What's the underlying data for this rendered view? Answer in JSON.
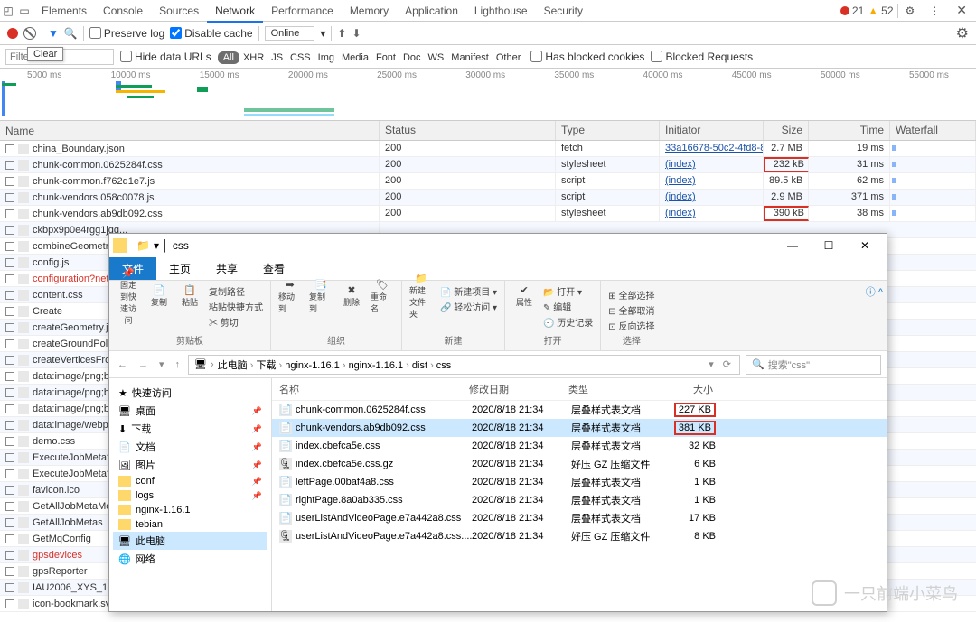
{
  "devtools": {
    "tabs": [
      "Elements",
      "Console",
      "Sources",
      "Network",
      "Performance",
      "Memory",
      "Application",
      "Lighthouse",
      "Security"
    ],
    "active_tab": "Network",
    "error_count": "21",
    "warning_count": "52",
    "preserve_log": "Preserve log",
    "disable_cache": "Disable cache",
    "throttle": "Online",
    "filter_placeholder": "Filter",
    "clear_tooltip": "Clear",
    "hide_data_urls": "Hide data URLs",
    "types": [
      "All",
      "XHR",
      "JS",
      "CSS",
      "Img",
      "Media",
      "Font",
      "Doc",
      "WS",
      "Manifest",
      "Other"
    ],
    "blocked_cookies": "Has blocked cookies",
    "blocked_requests": "Blocked Requests",
    "timeline_ticks": [
      "5000 ms",
      "10000 ms",
      "15000 ms",
      "20000 ms",
      "25000 ms",
      "30000 ms",
      "35000 ms",
      "40000 ms",
      "45000 ms",
      "50000 ms",
      "55000 ms"
    ],
    "columns": {
      "name": "Name",
      "status": "Status",
      "type": "Type",
      "initiator": "Initiator",
      "size": "Size",
      "time": "Time",
      "waterfall": "Waterfall"
    },
    "rows": [
      {
        "name": "china_Boundary.json",
        "status": "200",
        "type": "fetch",
        "initiator": "33a16678-50c2-4fd8-8...",
        "size": "2.7 MB",
        "time": "19 ms",
        "hl": false
      },
      {
        "name": "chunk-common.0625284f.css",
        "status": "200",
        "type": "stylesheet",
        "initiator": "(index)",
        "size": "232 kB",
        "time": "31 ms",
        "hl": true
      },
      {
        "name": "chunk-common.f762d1e7.js",
        "status": "200",
        "type": "script",
        "initiator": "(index)",
        "size": "89.5 kB",
        "time": "62 ms",
        "hl": false
      },
      {
        "name": "chunk-vendors.058c0078.js",
        "status": "200",
        "type": "script",
        "initiator": "(index)",
        "size": "2.9 MB",
        "time": "371 ms",
        "hl": false
      },
      {
        "name": "chunk-vendors.ab9db092.css",
        "status": "200",
        "type": "stylesheet",
        "initiator": "(index)",
        "size": "390 kB",
        "time": "38 ms",
        "hl": true
      },
      {
        "name": "ckbpx9p0e4rgg1jqq...",
        "red": false
      },
      {
        "name": "combineGeometr...",
        "red": false
      },
      {
        "name": "config.js",
        "red": false
      },
      {
        "name": "configuration?netw...",
        "red": true
      },
      {
        "name": "content.css",
        "red": false
      },
      {
        "name": "Create",
        "red": false
      },
      {
        "name": "createGeometry.j...",
        "red": false
      },
      {
        "name": "createGroundPoly...",
        "red": false
      },
      {
        "name": "createVerticesFro...",
        "red": false
      },
      {
        "name": "data:image/png;bas...",
        "red": false
      },
      {
        "name": "data:image/png;bas...",
        "red": false
      },
      {
        "name": "data:image/png;bas...",
        "red": false
      },
      {
        "name": "data:image/webp;ba...",
        "red": false
      },
      {
        "name": "demo.css",
        "red": false
      },
      {
        "name": "ExecuteJobMeta?na...",
        "red": false
      },
      {
        "name": "ExecuteJobMeta?na...",
        "red": false
      },
      {
        "name": "favicon.ico",
        "red": false
      },
      {
        "name": "GetAllJobMetaMod...",
        "red": false
      },
      {
        "name": "GetAllJobMetas",
        "red": false
      },
      {
        "name": "GetMqConfig",
        "red": false
      },
      {
        "name": "gpsdevices",
        "red": true
      },
      {
        "name": "gpsReporter",
        "red": false
      },
      {
        "name": "IAU2006_XYS_16.jso...",
        "red": false
      },
      {
        "name": "icon-bookmark.svg",
        "red": false
      }
    ]
  },
  "explorer": {
    "title_path": "css",
    "tabs": [
      "文件",
      "主页",
      "共享",
      "查看"
    ],
    "active_tab": "文件",
    "ribbon": {
      "pin": "固定到快速访问",
      "copy": "复制",
      "paste": "粘贴",
      "copy_path": "复制路径",
      "paste_shortcut": "粘贴快捷方式",
      "cut": "剪切",
      "clipboard": "剪贴板",
      "move_to": "移动到",
      "copy_to": "复制到",
      "delete": "删除",
      "rename": "重命名",
      "organize": "组织",
      "new_folder": "新建文件夹",
      "new_item": "新建项目",
      "easy_access": "轻松访问",
      "new": "新建",
      "properties": "属性",
      "open": "打开",
      "edit": "编辑",
      "history": "历史记录",
      "open_grp": "打开",
      "select_all": "全部选择",
      "select_none": "全部取消",
      "invert": "反向选择",
      "select": "选择"
    },
    "breadcrumbs": [
      "此电脑",
      "下载",
      "nginx-1.16.1",
      "nginx-1.16.1",
      "dist",
      "css"
    ],
    "search_placeholder": "搜索\"css\"",
    "side_items": [
      {
        "label": "快速访问",
        "icon": "star"
      },
      {
        "label": "桌面",
        "icon": "desktop",
        "pin": true
      },
      {
        "label": "下载",
        "icon": "download",
        "pin": true
      },
      {
        "label": "文档",
        "icon": "doc",
        "pin": true
      },
      {
        "label": "图片",
        "icon": "pic",
        "pin": true
      },
      {
        "label": "conf",
        "icon": "folder",
        "pin": true
      },
      {
        "label": "logs",
        "icon": "folder",
        "pin": true
      },
      {
        "label": "nginx-1.16.1",
        "icon": "folder"
      },
      {
        "label": "tebian",
        "icon": "folder"
      },
      {
        "label": "此电脑",
        "icon": "pc",
        "sel": true
      },
      {
        "label": "网络",
        "icon": "net"
      }
    ],
    "cols": {
      "name": "名称",
      "date": "修改日期",
      "type": "类型",
      "size": "大小"
    },
    "files": [
      {
        "name": "chunk-common.0625284f.css",
        "date": "2020/8/18 21:34",
        "type": "层叠样式表文档",
        "size": "227 KB",
        "hl": true
      },
      {
        "name": "chunk-vendors.ab9db092.css",
        "date": "2020/8/18 21:34",
        "type": "层叠样式表文档",
        "size": "381 KB",
        "sel": true,
        "hl": true
      },
      {
        "name": "index.cbefca5e.css",
        "date": "2020/8/18 21:34",
        "type": "层叠样式表文档",
        "size": "32 KB"
      },
      {
        "name": "index.cbefca5e.css.gz",
        "date": "2020/8/18 21:34",
        "type": "好压 GZ 压缩文件",
        "size": "6 KB",
        "gz": true
      },
      {
        "name": "leftPage.00baf4a8.css",
        "date": "2020/8/18 21:34",
        "type": "层叠样式表文档",
        "size": "1 KB"
      },
      {
        "name": "rightPage.8a0ab335.css",
        "date": "2020/8/18 21:34",
        "type": "层叠样式表文档",
        "size": "1 KB"
      },
      {
        "name": "userListAndVideoPage.e7a442a8.css",
        "date": "2020/8/18 21:34",
        "type": "层叠样式表文档",
        "size": "17 KB"
      },
      {
        "name": "userListAndVideoPage.e7a442a8.css....",
        "date": "2020/8/18 21:34",
        "type": "好压 GZ 压缩文件",
        "size": "8 KB",
        "gz": true
      }
    ]
  },
  "watermark": "一只前端小菜鸟"
}
